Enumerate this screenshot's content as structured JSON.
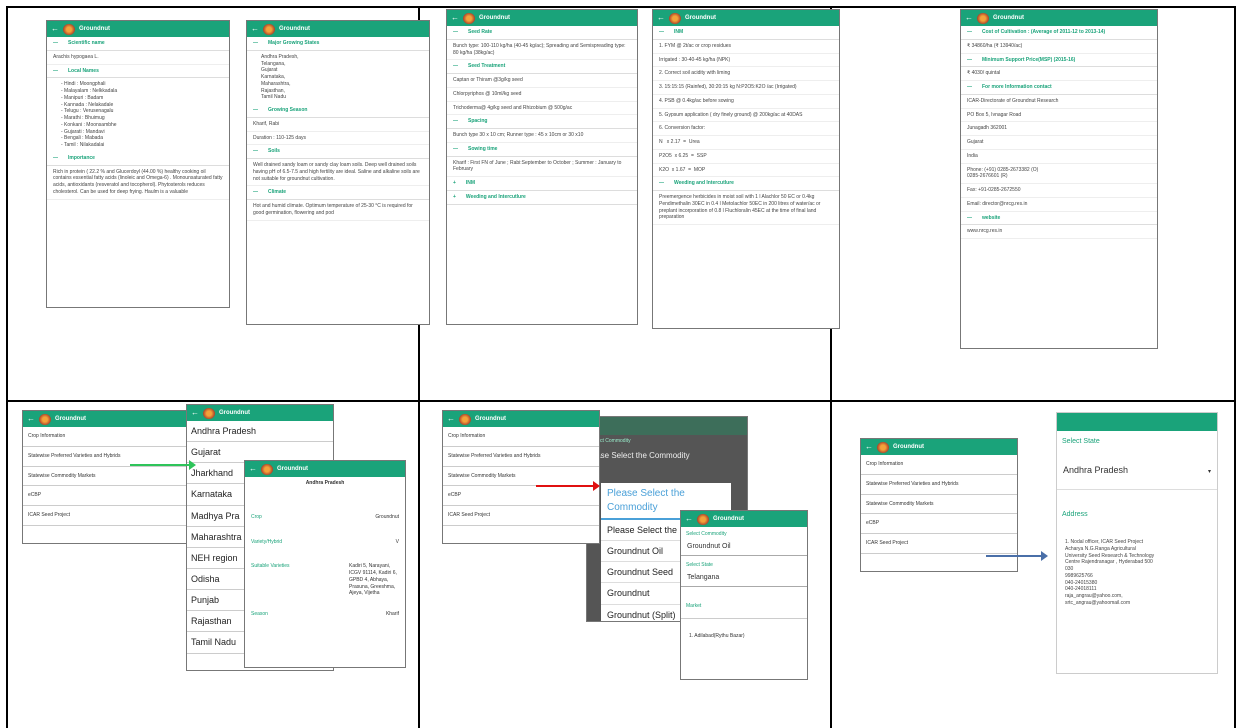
{
  "app_title": "Groundnut",
  "p1": {
    "s1": "Scientific name",
    "t1": "Arachis hypogaea L.",
    "s2": "Local Names",
    "t2": "- Hindi : Moongphali\n- Malayalam : Nelkkadala\n- Manipuri : Badam\n- Kannada : Nelakadale\n- Telugu : Verusenagalu\n- Marathi : Bhuimug\n- Konkani : Moonsambhe\n- Gujarati : Mandavi\n- Bengali : Mabada\n- Tamil : Nilakadalai",
    "s3": "Importance",
    "t3": "Rich in protein ( 22.2 % and Glucerdoyl (44.00 %) healthy cooking oil contains essential fatty acids (linoleic and Omega-6) . Monounsaturated fatty acids, antioxidants (resveratol and tocopherol). Phytosterols reduces cholesterol. Can be used for deep frying. Haulm is a valuable"
  },
  "p2": {
    "s1": "Major Growing States",
    "t1": "Andhra Pradesh,\nTelangana,\nGujarat\nKarnataka,\nMaharashtra,\nRajasthan,\nTamil Nadu",
    "s2": "Growing Season",
    "t2": "Kharif, Rabi",
    "t3": "Duration : 110-125 days",
    "s3": "Soils",
    "t4": "Well drained sandy loam or sandy clay loam soils. Deep well drained soils having pH of 6.5-7.5 and high fertility are ideal. Saline and alkaline soils are not suitable for groundnut cultivation.",
    "s4": "Climate",
    "t5": "Hot and humid climate. Optimum temperature of 25-30 °C is required for good germination, flowering and pod"
  },
  "p3": {
    "s1": "Seed Rate",
    "t1": "Bunch type: 100-110 kg/ha (40-45 kg/ac); Spreading and Semispreading type: 80 kg/ha (38kg/ac)",
    "s2": "Seed Treatment",
    "t2": "Captan or Thiram @3g/kg seed",
    "t3": "Chlorpyriphos @ 10ml/kg seed",
    "t4": "Trichoderma@ 4g/kg seed and Rhizobium @ 500g/ac",
    "s3": "Spacing",
    "t5": "Bunch type 30 x 10 cm; Runner type : 45 x 10cm or 30 x10",
    "s4": "Sowing time",
    "t6": "Kharif : First FN of June ; Rabi:September to October ; Summer : January to February",
    "s5": "INM",
    "s6": "Weeding and Intercutlure"
  },
  "p4": {
    "s1": "INM",
    "t1": "1. FYM @ 2t/ac or crop residues",
    "t2": "Irrigated : 30-40-45 kg/ha (NPK)",
    "t3": "2. Correct soil acidity with liming",
    "t4": "3. 15:15:15 (Rainfed), 30:20:15 kg N:P2O5:K2O /ac (Irrigated)",
    "t5": "4. PSB @ 0.4kg/ac before sowing",
    "t6": "5. Gypsum application ( dry finely ground) @ 200kg/ac at 40DAS",
    "t7": "6. Conversion factor:",
    "t8": "N   x 2.17  =  Urea",
    "t9": "P2O5  x 6.25  =  SSP",
    "t10": "K2O  x 1.67  =  MOP",
    "s2": "Weeding and Intercutlure",
    "t11": "Preemergence herbicides in moist soil with 1 l Alachlor 50 EC or 0.4kg Pendimethalin 30EC in 0.4 l Metolachlor 50EC in 200 litres of water/ac or preplant incorporation of 0.8 l Fluchloralin 45EC at the time of final land preparation"
  },
  "p5": {
    "s1": "Cost of Cultivation : (Average of 2011-12 to 2013-14)",
    "t1": "₹ 34860/ha (₹ 13940/ac)",
    "s2": "Minimum Support Price(MSP) (2015-16)",
    "t2": "₹ 4030/ quintal",
    "s3": "For more Information contact",
    "t3": "ICAR-Directorate of Groundnut Research",
    "t4": "PO Box 5, Ivnagar Road",
    "t5": "Junagadh 362001",
    "t6": "Gujarat",
    "t7": "India",
    "t8": "Phone: (+91) 0285-2673382 (O)\n0285-2676601 (R)",
    "t9": "Fax: +91-0285-2672550",
    "t10": "Email: director@nrcg.res.in",
    "s4": "website",
    "t11": "www.nrcg.res.in"
  },
  "menu": [
    "Crop Information",
    "Statewise Preferred Varieties and Hybrids",
    "Statewise Commodity Markets",
    "eCBP",
    "ICAR Seed Project"
  ],
  "states": [
    "Andhra Pradesh",
    "Gujarat",
    "Jharkhand",
    "Karnataka",
    "Madhya Pra",
    "Maharashtra",
    "NEH region",
    "Odisha",
    "Punjab",
    "Rajasthan",
    "Tamil Nadu"
  ],
  "variety": {
    "header": "Andhra Pradesh",
    "r1k": "Crop",
    "r1v": "Groundnut",
    "r2k": "Variety/Hybrid",
    "r2v": "V",
    "r3k": "Suitable Varieties",
    "r3v": "Kadiri 5, Narayani, ICGV 91114, Kadiri 6, GPBD 4, Abhaya, Prasuna, Greeshma, Ajeya, Vijetha",
    "r4k": "Season",
    "r4v": "Kharif"
  },
  "commodity": {
    "label": "Select Commodity",
    "prompt": "Please Select the Commodity",
    "options": [
      "Please Select the",
      "Groundnut Oil",
      "Groundnut Seed",
      "Groundnut",
      "Groundnut (Split)"
    ],
    "dialog_header": "Please Select the Commodity",
    "dialog_prompt": "lease Select the Commodity"
  },
  "market": {
    "l1": "Select Commodity",
    "v1": "Groundnut Oil",
    "l2": "Select State",
    "v2": "Telangana",
    "l3": "Market",
    "v3": "1. Adilabad(Rythu Bazar)"
  },
  "seed": {
    "l1": "Select State",
    "v1": "Andhra Pradesh",
    "l2": "Address",
    "addr": "1. Nodal officer, ICAR Seed Project\nAcharya N.G.Ranga Agricultural\nUniversity Seed Research & Technology\nCentre Rajendranagar , Hyderabad 500\n030\n9989625766\n040-24015380\n040-24018111\nraja_angrau@yahoo.com,\nsrtc_angrau@yahoomail.com"
  },
  "colors": {
    "appbar": "#1aa37a",
    "arrow_green": "#2ec45a",
    "arrow_red": "#e01010",
    "arrow_blue": "#4a6fa8"
  }
}
